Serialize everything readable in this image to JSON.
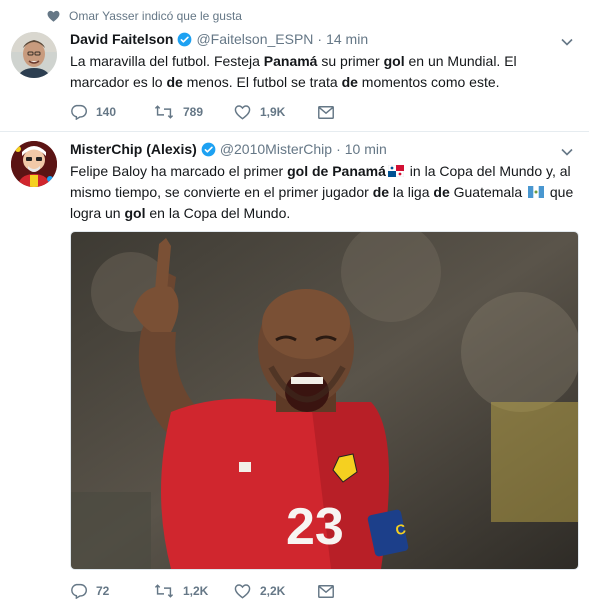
{
  "tweet1": {
    "social_context": "Omar Yasser indicó que le gusta",
    "author_name": "David Faitelson",
    "handle": "@Faitelson_ESPN",
    "time": "14 min",
    "text_parts": [
      "La maravilla del futbol. Festeja ",
      "Panamá",
      " su primer ",
      "gol",
      " en un Mundial. El marcador es lo ",
      "de",
      " menos. El futbol se trata ",
      "de",
      " momentos como este."
    ],
    "replies": "140",
    "retweets": "789",
    "likes": "1,9K"
  },
  "tweet2": {
    "author_name": "MisterChip (Alexis)",
    "handle": "@2010MisterChip",
    "time": "10 min",
    "text_parts": [
      "Felipe Baloy ha marcado el primer ",
      "gol de Panamá",
      " in la Copa del Mundo y, al mismo tiempo, se convierte en el primer jugador ",
      "de",
      " la liga ",
      "de",
      " Guatemala ",
      " que logra un ",
      "gol",
      " en la Copa del Mundo."
    ],
    "image_jersey_number": "23",
    "replies": "72",
    "retweets": "1,2K",
    "likes": "2,2K"
  },
  "colors": {
    "verified": "#1da1f2",
    "muted": "#657786",
    "jersey": "#d0262e"
  },
  "icons": [
    "heart-icon",
    "verified-badge-icon",
    "chevron-down-icon",
    "reply-icon",
    "retweet-icon",
    "like-icon",
    "direct-message-icon",
    "panama-flag-icon",
    "guatemala-flag-icon"
  ]
}
